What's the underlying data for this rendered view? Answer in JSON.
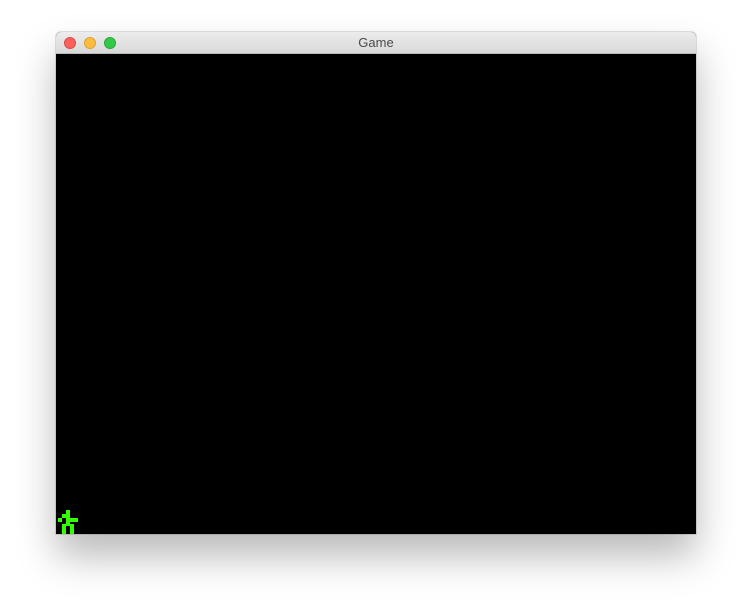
{
  "window": {
    "title": "Game"
  },
  "titlebar": {
    "buttons": [
      "close",
      "minimize",
      "zoom"
    ]
  },
  "game": {
    "background_color": "#000000",
    "player": {
      "color": "#33ff00",
      "icon": "pixel-stick-figure-icon"
    }
  }
}
